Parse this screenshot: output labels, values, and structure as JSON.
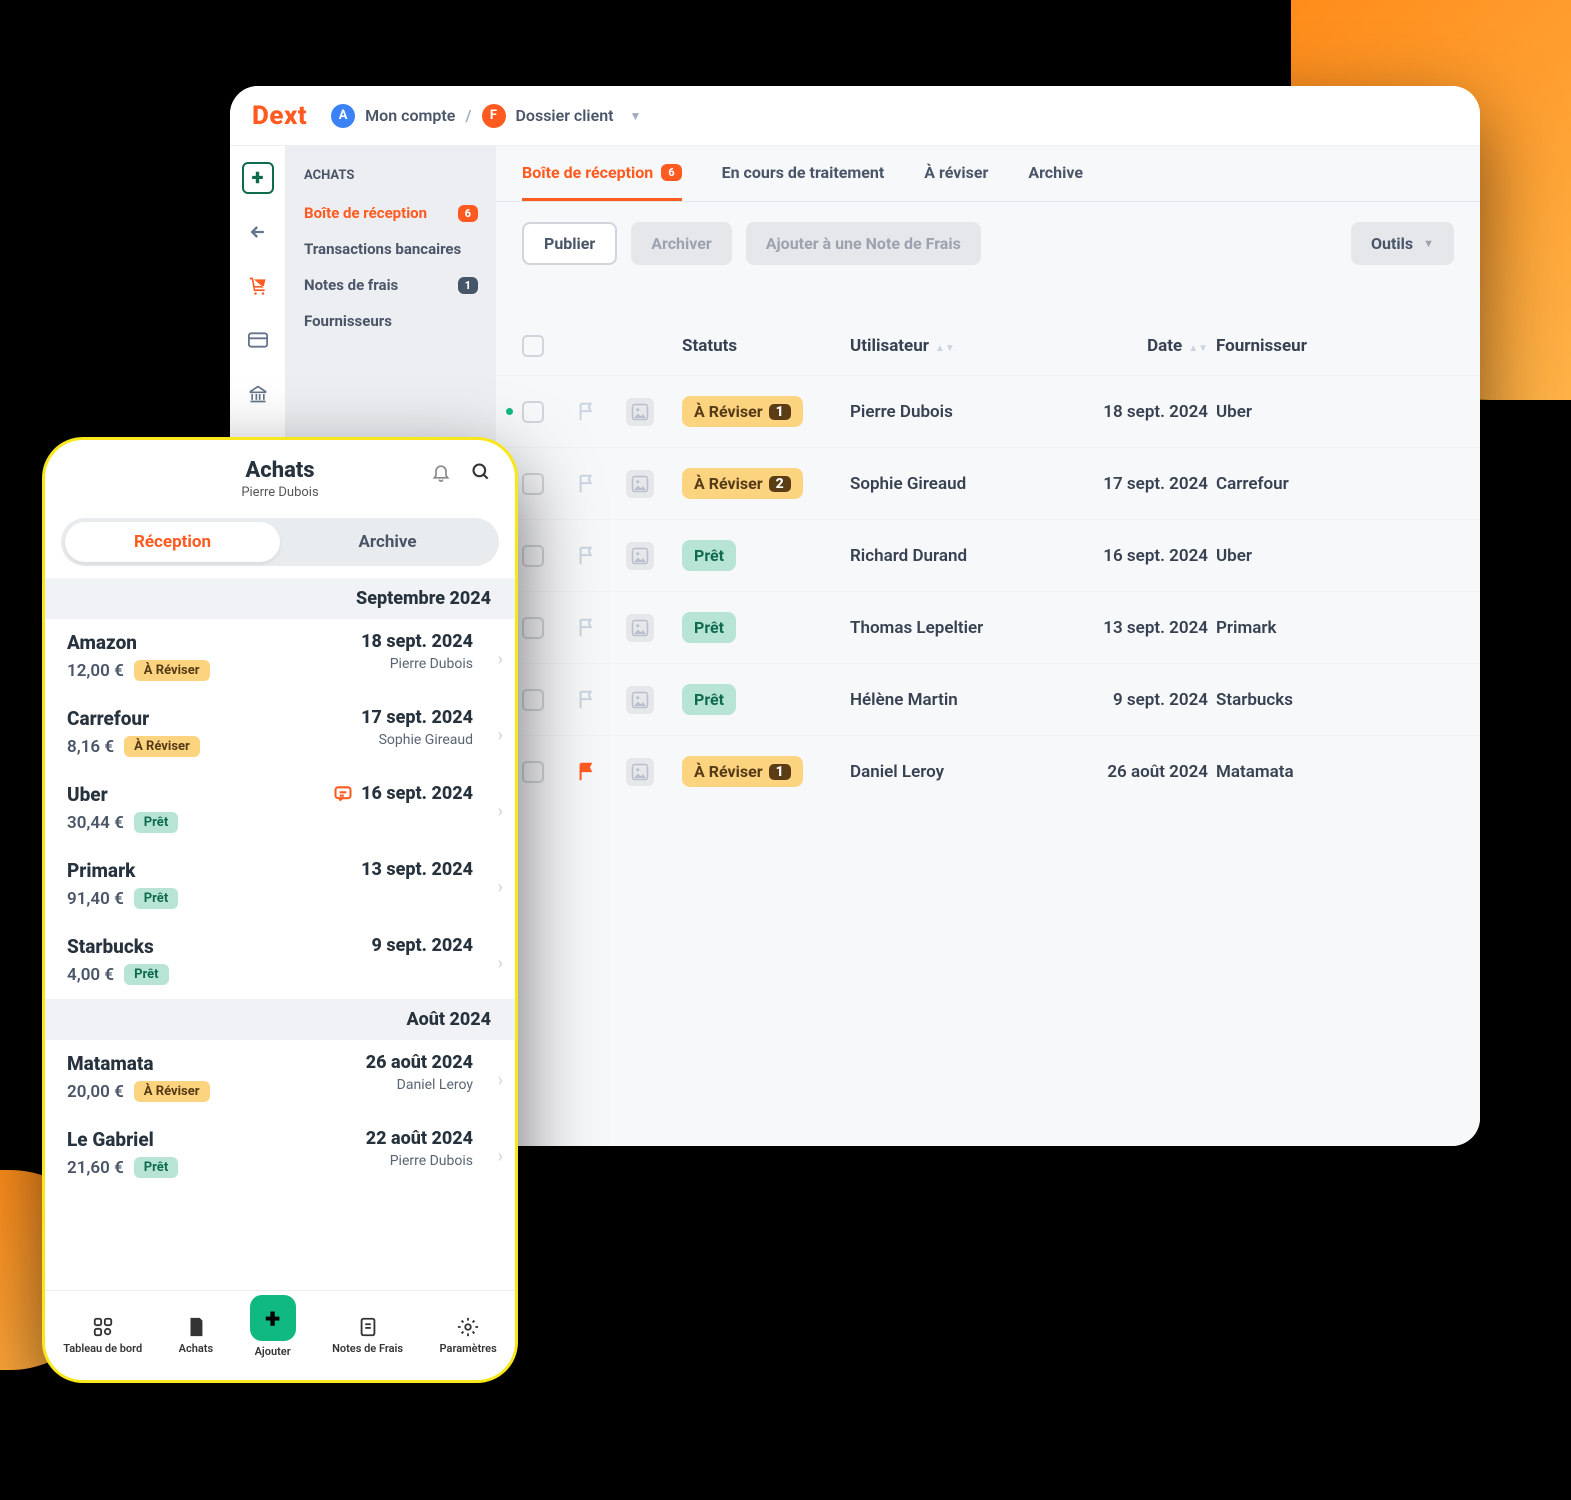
{
  "desktop": {
    "logo": "Dext",
    "breadcrumb": {
      "account_avatar": "A",
      "account": "Mon compte",
      "client_avatar": "F",
      "client": "Dossier client"
    },
    "sidebar": {
      "section": "ACHATS",
      "items": [
        {
          "label": "Boîte de réception",
          "badge": "6",
          "active": true
        },
        {
          "label": "Transactions bancaires"
        },
        {
          "label": "Notes de frais",
          "badge": "1"
        },
        {
          "label": "Fournisseurs"
        }
      ]
    },
    "tabs": [
      {
        "label": "Boîte de réception",
        "badge": "6",
        "active": true
      },
      {
        "label": "En cours de traitement"
      },
      {
        "label": "À réviser"
      },
      {
        "label": "Archive"
      }
    ],
    "toolbar": {
      "publish": "Publier",
      "archive": "Archiver",
      "note": "Ajouter à une Note de Frais",
      "tools": "Outils"
    },
    "columns": {
      "status": "Statuts",
      "user": "Utilisateur",
      "date": "Date",
      "supplier": "Fournisseur"
    },
    "rows": [
      {
        "dot": true,
        "status": "À Réviser",
        "status_badge": "1",
        "status_type": "warn",
        "user": "Pierre Dubois",
        "date": "18 sept. 2024",
        "supplier": "Uber"
      },
      {
        "status": "À Réviser",
        "status_badge": "2",
        "status_type": "warn",
        "user": "Sophie Gireaud",
        "date": "17 sept. 2024",
        "supplier": "Carrefour"
      },
      {
        "status": "Prêt",
        "status_type": "ok",
        "user": "Richard Durand",
        "date": "16 sept. 2024",
        "supplier": "Uber"
      },
      {
        "status": "Prêt",
        "status_type": "ok",
        "user": "Thomas Lepeltier",
        "date": "13 sept. 2024",
        "supplier": "Primark"
      },
      {
        "dot": true,
        "status": "Prêt",
        "status_type": "ok",
        "user": "Hélène Martin",
        "date": "9 sept. 2024",
        "supplier": "Starbucks"
      },
      {
        "flag": true,
        "status": "À Réviser",
        "status_badge": "1",
        "status_type": "warn",
        "user": "Daniel Leroy",
        "date": "26 août 2024",
        "supplier": "Matamata"
      }
    ]
  },
  "mobile": {
    "title": "Achats",
    "subtitle": "Pierre Dubois",
    "segments": {
      "reception": "Réception",
      "archive": "Archive"
    },
    "sections": [
      {
        "heading": "Septembre 2024",
        "items": [
          {
            "name": "Amazon",
            "price": "12,00 €",
            "status": "À Réviser",
            "status_type": "warn",
            "date": "18 sept. 2024",
            "user": "Pierre Dubois"
          },
          {
            "name": "Carrefour",
            "price": "8,16 €",
            "status": "À Réviser",
            "status_type": "warn",
            "date": "17 sept. 2024",
            "user": "Sophie Gireaud"
          },
          {
            "name": "Uber",
            "price": "30,44 €",
            "status": "Prêt",
            "status_type": "ok",
            "date": "16 sept. 2024",
            "msg": true
          },
          {
            "name": "Primark",
            "price": "91,40 €",
            "status": "Prêt",
            "status_type": "ok",
            "date": "13 sept. 2024"
          },
          {
            "name": "Starbucks",
            "price": "4,00 €",
            "status": "Prêt",
            "status_type": "ok",
            "date": "9 sept. 2024"
          }
        ]
      },
      {
        "heading": "Août 2024",
        "items": [
          {
            "name": "Matamata",
            "price": "20,00 €",
            "status": "À Réviser",
            "status_type": "warn",
            "date": "26 août 2024",
            "user": "Daniel Leroy"
          },
          {
            "name": "Le Gabriel",
            "price": "21,60 €",
            "status": "Prêt",
            "status_type": "ok",
            "date": "22 août 2024",
            "user": "Pierre Dubois"
          }
        ]
      }
    ],
    "bottomnav": {
      "dashboard": "Tableau de bord",
      "purchases": "Achats",
      "add": "Ajouter",
      "notes": "Notes de Frais",
      "settings": "Paramètres"
    }
  }
}
